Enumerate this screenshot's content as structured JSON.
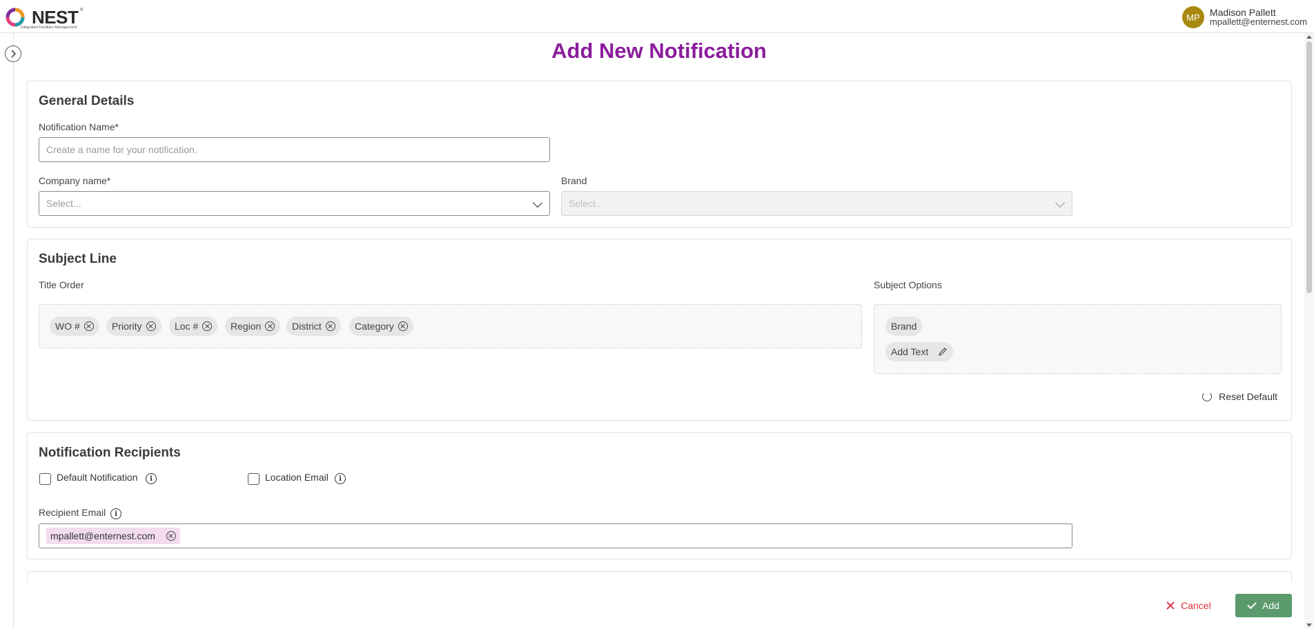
{
  "header": {
    "logo_text": "NEST",
    "logo_tagline": "Integrated Facilities Management",
    "logo_reg": "®",
    "user": {
      "initials": "MP",
      "name": "Madison Pallett",
      "email": "mpallett@enternest.com"
    }
  },
  "page_title": "Add New Notification",
  "general": {
    "title": "General Details",
    "notification_name_label": "Notification Name*",
    "notification_name_placeholder": "Create a name for your notification.",
    "company_label": "Company name*",
    "company_placeholder": "Select...",
    "brand_label": "Brand",
    "brand_placeholder": "Select..."
  },
  "subject": {
    "title": "Subject Line",
    "title_order_label": "Title Order",
    "title_order_chips": [
      "WO #",
      "Priority",
      "Loc #",
      "Region",
      "District",
      "Category"
    ],
    "subject_options_label": "Subject Options",
    "subject_options": [
      "Brand",
      "Add Text"
    ],
    "reset_label": "Reset Default"
  },
  "recipients": {
    "title": "Notification Recipients",
    "default_notification_label": "Default Notification",
    "location_email_label": "Location Email",
    "recipient_email_label": "Recipient Email",
    "emails": [
      "mpallett@enternest.com"
    ]
  },
  "footer": {
    "cancel_label": "Cancel",
    "add_label": "Add"
  },
  "colors": {
    "title_purple": "#8b1d9c",
    "add_green": "#5a9a6c",
    "cancel_red": "#d9343f",
    "avatar_gold": "#a8880f",
    "email_chip_pink": "#f3dcef"
  }
}
